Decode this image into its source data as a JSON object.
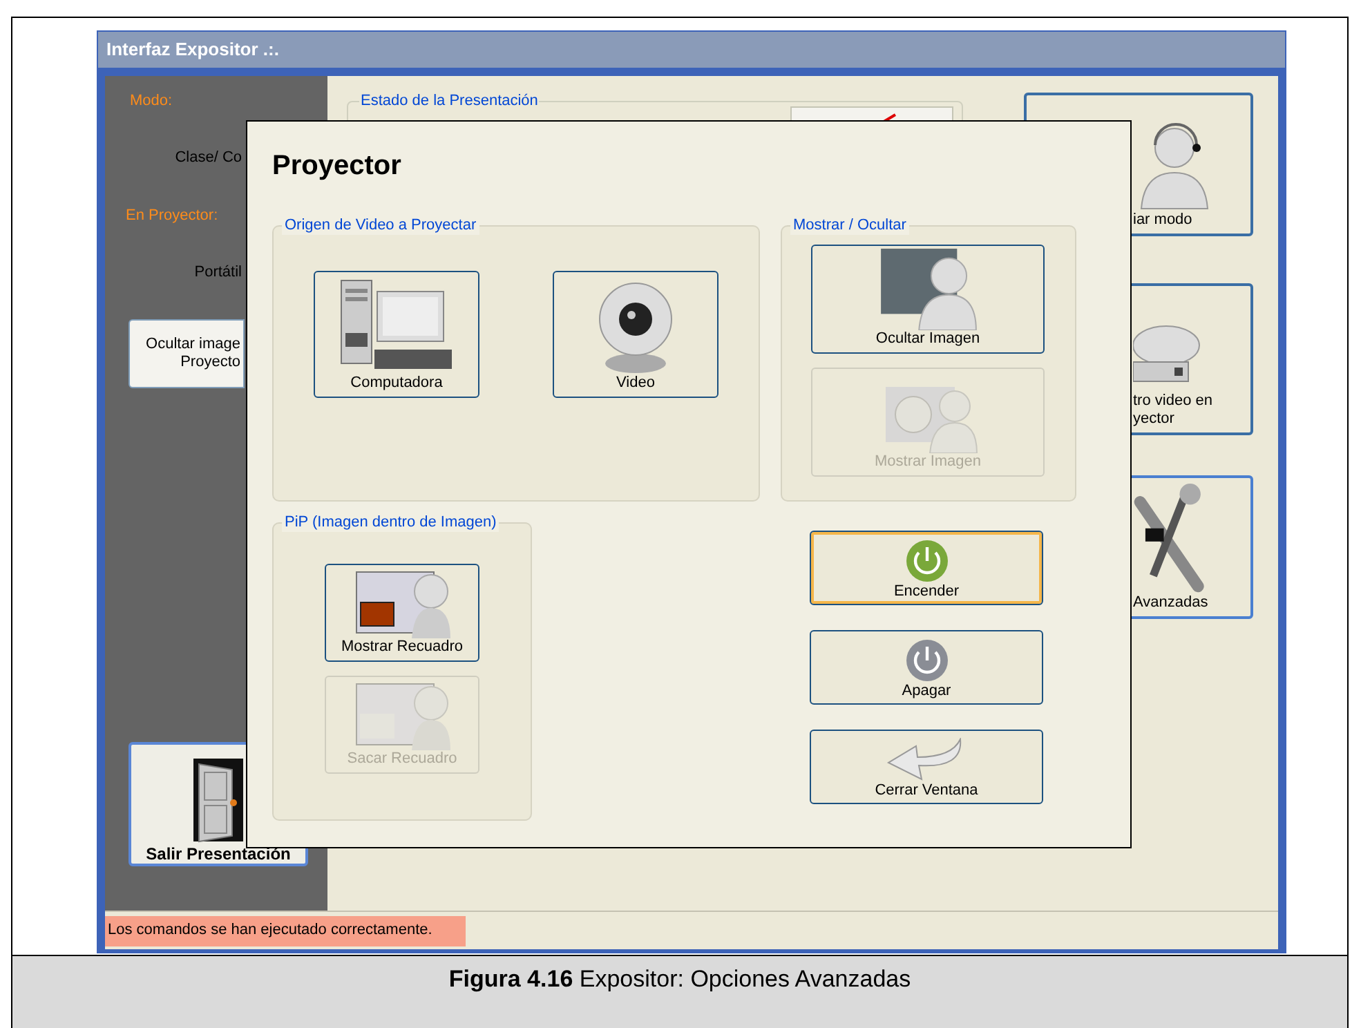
{
  "window": {
    "title": "Interfaz Expositor .:.",
    "status_message": "Los comandos se han ejecutado correctamente."
  },
  "left_panel": {
    "mode_label": "Modo:",
    "mode_value": "Clase/ Co",
    "projector_label": "En Proyector:",
    "projector_value": "Portátil",
    "hide_button": [
      "Ocultar image",
      "Proyecto"
    ],
    "exit_button": "Salir Presentación"
  },
  "status_group": {
    "title": "Estado de la Presentación"
  },
  "right_buttons": [
    {
      "kind": "headset",
      "lines": [
        "iar modo"
      ]
    },
    {
      "kind": "video",
      "lines": [
        "tro video en",
        "yector"
      ]
    },
    {
      "kind": "tools",
      "lines": [
        "Avanzadas"
      ]
    }
  ],
  "dialog": {
    "title": "Proyector",
    "groups": [
      {
        "title": "Origen de Video a Proyectar",
        "buttons": [
          {
            "kind": "computer",
            "label": "Computadora",
            "disabled": false
          },
          {
            "kind": "webcam",
            "label": "Video",
            "disabled": false
          }
        ]
      },
      {
        "title": "Mostrar / Ocultar",
        "buttons": [
          {
            "kind": "hide",
            "label": "Ocultar Imagen",
            "disabled": false
          },
          {
            "kind": "show",
            "label": "Mostrar Imagen",
            "disabled": true
          }
        ]
      },
      {
        "title": "PiP (Imagen dentro de Imagen)",
        "buttons": [
          {
            "kind": "pip",
            "label": "Mostrar Recuadro",
            "disabled": false
          },
          {
            "kind": "pip-off",
            "label": "Sacar Recuadro",
            "disabled": true
          }
        ]
      }
    ],
    "actions": [
      {
        "kind": "power-on",
        "label": "Encender",
        "focused": true
      },
      {
        "kind": "power-off",
        "label": "Apagar",
        "focused": false
      },
      {
        "kind": "back",
        "label": "Cerrar Ventana",
        "focused": false
      }
    ]
  },
  "caption": "**Figura 4.16** Expositor: Opciones Avanzadas"
}
